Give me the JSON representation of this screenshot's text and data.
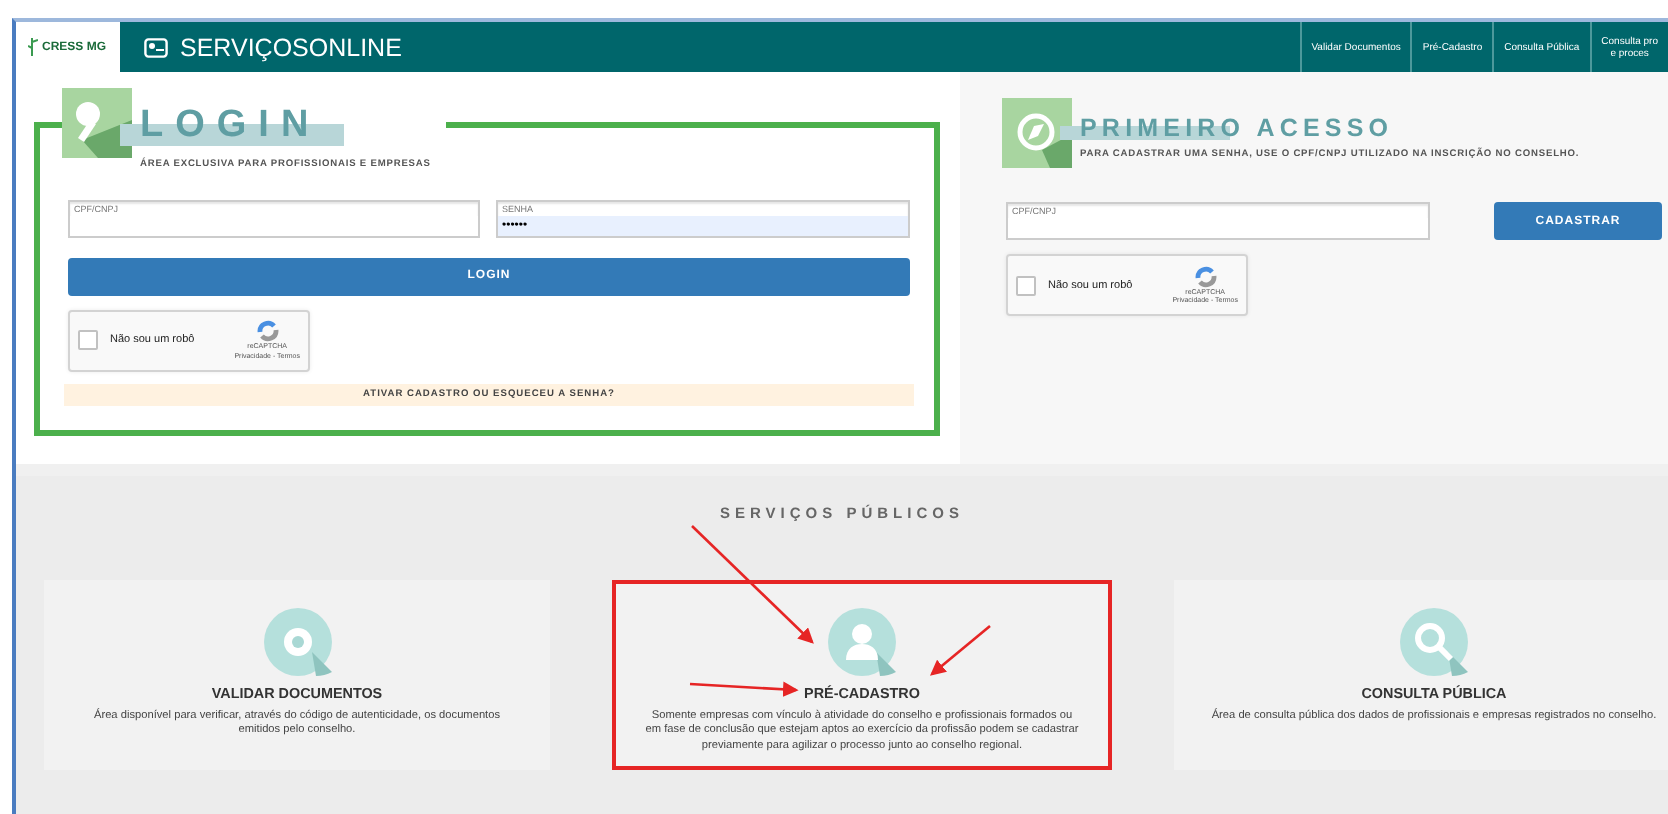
{
  "header": {
    "logo": "CRESS MG",
    "title": "SERVIÇOSONLINE",
    "nav": [
      {
        "lines": [
          "Validar Documentos"
        ]
      },
      {
        "lines": [
          "Pré-Cadastro"
        ]
      },
      {
        "lines": [
          "Consulta Pública"
        ]
      },
      {
        "lines": [
          "Consulta pro",
          "e proces"
        ]
      }
    ]
  },
  "login": {
    "title": "LOGIN",
    "subtitle": "ÁREA EXCLUSIVA PARA PROFISSIONAIS E EMPRESAS",
    "fields": [
      {
        "label": "CPF/CNPJ",
        "autofilled": false
      },
      {
        "label": "SENHA",
        "value": "••••••",
        "autofilled": true
      }
    ],
    "button": "LOGIN",
    "captcha": {
      "label": "Não sou um robô",
      "checked": false,
      "brand": "reCAPTCHA",
      "links": "Privacidade - Termos"
    },
    "link": "ATIVAR CADASTRO OU ESQUECEU A SENHA?"
  },
  "first_access": {
    "title": "PRIMEIRO ACESSO",
    "subtitle": "PARA CADASTRAR UMA SENHA, USE O CPF/CNPJ UTILIZADO NA INSCRIÇÃO NO CONSELHO.",
    "field": {
      "label": "CPF/CNPJ"
    },
    "button": "CADASTRAR",
    "captcha": {
      "label": "Não sou um robô",
      "checked": false,
      "brand": "reCAPTCHA",
      "links": "Privacidade - Termos"
    }
  },
  "services": {
    "title": "SERVIÇOS PÚBLICOS",
    "cards": [
      {
        "kind": "seal",
        "title": "VALIDAR DOCUMENTOS",
        "description": "Área disponível para verificar, através do código de autenticidade, os documentos emitidos pelo conselho.",
        "highlighted": false
      },
      {
        "kind": "person",
        "title": "PRÉ-CADASTRO",
        "description": "Somente empresas com vínculo à atividade do conselho e profissionais formados ou em fase de conclusão que estejam aptos ao exercício da profissão podem se cadastrar previamente para agilizar o processo junto ao conselho regional.",
        "highlighted": true
      },
      {
        "kind": "search",
        "title": "CONSULTA PÚBLICA",
        "description": "Área de consulta pública dos dados de profissionais e empresas registrados no conselho.",
        "highlighted": false
      }
    ]
  }
}
